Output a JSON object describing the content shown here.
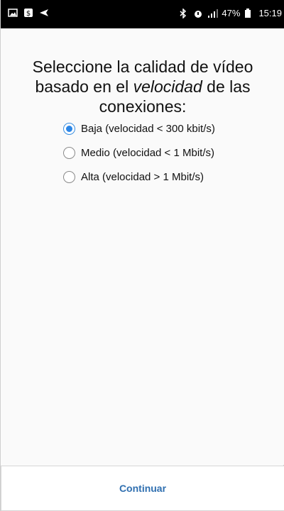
{
  "status_bar": {
    "left_icons": [
      "image-icon",
      "dollar-badge-icon",
      "send-icon"
    ],
    "bluetooth_icon": "bluetooth-icon",
    "alarm_icon": "alarm-icon",
    "signal_icon": "signal-icon",
    "battery_percent": "47%",
    "battery_icon": "battery-icon",
    "time": "15:19"
  },
  "main": {
    "title_part1": "Seleccione la calidad de vídeo basado en el ",
    "title_em": "velocidad",
    "title_part2": " de las conexiones:",
    "options": [
      {
        "label": "Baja (velocidad < 300 kbit/s)",
        "selected": true
      },
      {
        "label": "Medio (velocidad < 1 Mbit/s)",
        "selected": false
      },
      {
        "label": "Alta (velocidad > 1 Mbit/s)",
        "selected": false
      }
    ]
  },
  "footer": {
    "continue_label": "Continuar"
  },
  "colors": {
    "accent_radio": "#2c86e6",
    "button_text": "#2f6fb0"
  }
}
